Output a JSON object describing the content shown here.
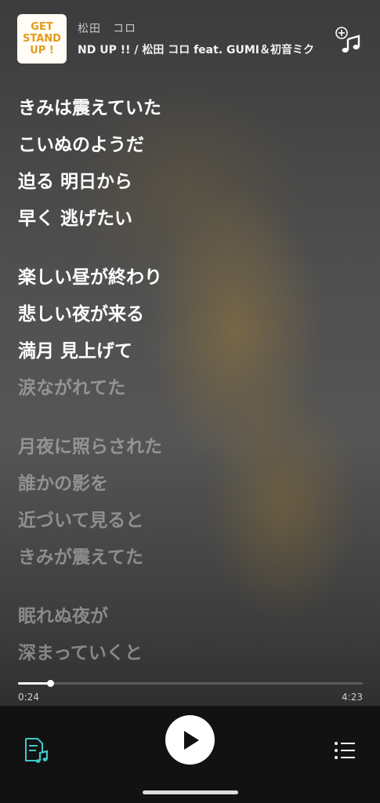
{
  "header": {
    "album_art_lines": [
      "GET",
      "STAND",
      "UP !"
    ],
    "artist": "松田　コロ",
    "song_line": "ND UP !! / 松田 コロ feat. GUMI＆初音ミク",
    "add_to_playlist_icon": "add-music-icon"
  },
  "lyrics": {
    "stanzas": [
      {
        "lines": [
          "きみは震えていた",
          "こいぬのようだ",
          "迫る 明日から",
          "早く 逃げたい"
        ],
        "state": "current"
      },
      {
        "lines": [
          "楽しい昼が終わり",
          "悲しい夜が来る",
          "満月 見上げて"
        ],
        "state": "current",
        "extra": "涙ながれてた"
      },
      {
        "lines": [
          "月夜に照らされた",
          "誰かの影を",
          "近づいて見ると",
          "きみが震えてた"
        ],
        "state": "upcoming"
      },
      {
        "lines": [
          "眠れぬ夜が",
          "深まっていくと"
        ],
        "state": "upcoming"
      }
    ]
  },
  "player": {
    "current_time": "0:24",
    "total_time": "4:23",
    "progress": 0.093,
    "accent_color": "#3ec9c9"
  },
  "controls": {
    "lyrics_icon": "lyrics-note-icon",
    "play_icon": "play-icon",
    "queue_icon": "queue-list-icon"
  }
}
